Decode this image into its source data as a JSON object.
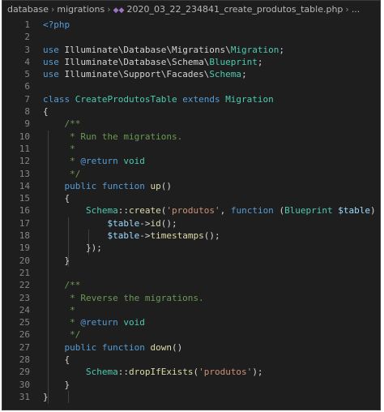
{
  "breadcrumb": {
    "items": [
      "database",
      "migrations"
    ],
    "file": "2020_03_22_234841_create_produtos_table.php",
    "ellipsis": "...",
    "file_icon": "php-elephant-icon"
  },
  "code_lines": [
    {
      "n": "1",
      "tokens": [
        [
          "kw",
          "<?php"
        ]
      ]
    },
    {
      "n": "2",
      "tokens": []
    },
    {
      "n": "3",
      "tokens": [
        [
          "kw",
          "use "
        ],
        [
          "ns",
          "Illuminate\\Database\\Migrations\\"
        ],
        [
          "cls",
          "Migration"
        ],
        [
          "punc",
          ";"
        ]
      ]
    },
    {
      "n": "4",
      "tokens": [
        [
          "kw",
          "use "
        ],
        [
          "ns",
          "Illuminate\\Database\\Schema\\"
        ],
        [
          "cls",
          "Blueprint"
        ],
        [
          "punc",
          ";"
        ]
      ]
    },
    {
      "n": "5",
      "tokens": [
        [
          "kw",
          "use "
        ],
        [
          "ns",
          "Illuminate\\Support\\Facades\\"
        ],
        [
          "cls",
          "Schema"
        ],
        [
          "punc",
          ";"
        ]
      ]
    },
    {
      "n": "6",
      "tokens": []
    },
    {
      "n": "7",
      "tokens": [
        [
          "kw",
          "class "
        ],
        [
          "cls",
          "CreateProdutosTable "
        ],
        [
          "kw",
          "extends "
        ],
        [
          "cls",
          "Migration"
        ]
      ]
    },
    {
      "n": "8",
      "tokens": [
        [
          "punc",
          "{"
        ]
      ]
    },
    {
      "n": "9",
      "tokens": [
        [
          "cmt",
          "    /**"
        ]
      ]
    },
    {
      "n": "10",
      "tokens": [
        [
          "cmt",
          "     * Run the migrations."
        ]
      ]
    },
    {
      "n": "11",
      "tokens": [
        [
          "cmt",
          "     *"
        ]
      ]
    },
    {
      "n": "12",
      "tokens": [
        [
          "cmt",
          "     * "
        ],
        [
          "kw",
          "@return "
        ],
        [
          "cls",
          "void"
        ]
      ]
    },
    {
      "n": "13",
      "tokens": [
        [
          "cmt",
          "     */"
        ]
      ]
    },
    {
      "n": "14",
      "tokens": [
        [
          "kw",
          "    public function "
        ],
        [
          "fn",
          "up"
        ],
        [
          "punc",
          "()"
        ]
      ]
    },
    {
      "n": "15",
      "tokens": [
        [
          "punc",
          "    {"
        ]
      ]
    },
    {
      "n": "16",
      "tokens": [
        [
          "cls",
          "        Schema"
        ],
        [
          "punc",
          "::"
        ],
        [
          "fn",
          "create"
        ],
        [
          "punc",
          "("
        ],
        [
          "str",
          "'produtos'"
        ],
        [
          "punc",
          ", "
        ],
        [
          "kw",
          "function "
        ],
        [
          "punc",
          "("
        ],
        [
          "cls",
          "Blueprint "
        ],
        [
          "var",
          "$table"
        ],
        [
          "punc",
          ") {"
        ]
      ]
    },
    {
      "n": "17",
      "tokens": [
        [
          "var",
          "            $table"
        ],
        [
          "punc",
          "->"
        ],
        [
          "fn",
          "id"
        ],
        [
          "punc",
          "();"
        ]
      ]
    },
    {
      "n": "18",
      "tokens": [
        [
          "var",
          "            $table"
        ],
        [
          "punc",
          "->"
        ],
        [
          "fn",
          "timestamps"
        ],
        [
          "punc",
          "();"
        ]
      ]
    },
    {
      "n": "19",
      "tokens": [
        [
          "punc",
          "        });"
        ]
      ]
    },
    {
      "n": "20",
      "tokens": [
        [
          "punc",
          "    }"
        ]
      ]
    },
    {
      "n": "21",
      "tokens": []
    },
    {
      "n": "22",
      "tokens": [
        [
          "cmt",
          "    /**"
        ]
      ]
    },
    {
      "n": "23",
      "tokens": [
        [
          "cmt",
          "     * Reverse the migrations."
        ]
      ]
    },
    {
      "n": "24",
      "tokens": [
        [
          "cmt",
          "     *"
        ]
      ]
    },
    {
      "n": "25",
      "tokens": [
        [
          "cmt",
          "     * "
        ],
        [
          "kw",
          "@return "
        ],
        [
          "cls",
          "void"
        ]
      ]
    },
    {
      "n": "26",
      "tokens": [
        [
          "cmt",
          "     */"
        ]
      ]
    },
    {
      "n": "27",
      "tokens": [
        [
          "kw",
          "    public function "
        ],
        [
          "fn",
          "down"
        ],
        [
          "punc",
          "()"
        ]
      ]
    },
    {
      "n": "28",
      "tokens": [
        [
          "punc",
          "    {"
        ]
      ]
    },
    {
      "n": "29",
      "tokens": [
        [
          "cls",
          "        Schema"
        ],
        [
          "punc",
          "::"
        ],
        [
          "fn",
          "dropIfExists"
        ],
        [
          "punc",
          "("
        ],
        [
          "str",
          "'produtos'"
        ],
        [
          "punc",
          ");"
        ]
      ]
    },
    {
      "n": "30",
      "tokens": [
        [
          "punc",
          "    }"
        ]
      ]
    },
    {
      "n": "31",
      "tokens": [
        [
          "punc",
          "}"
        ]
      ]
    }
  ],
  "colors": {
    "background": "#1e1e1e",
    "keyword": "#569cd6",
    "class": "#4ec9b0",
    "function": "#dcdcaa",
    "string": "#ce9178",
    "variable": "#9cdcfe",
    "comment": "#6a9955",
    "line_number": "#858585"
  }
}
